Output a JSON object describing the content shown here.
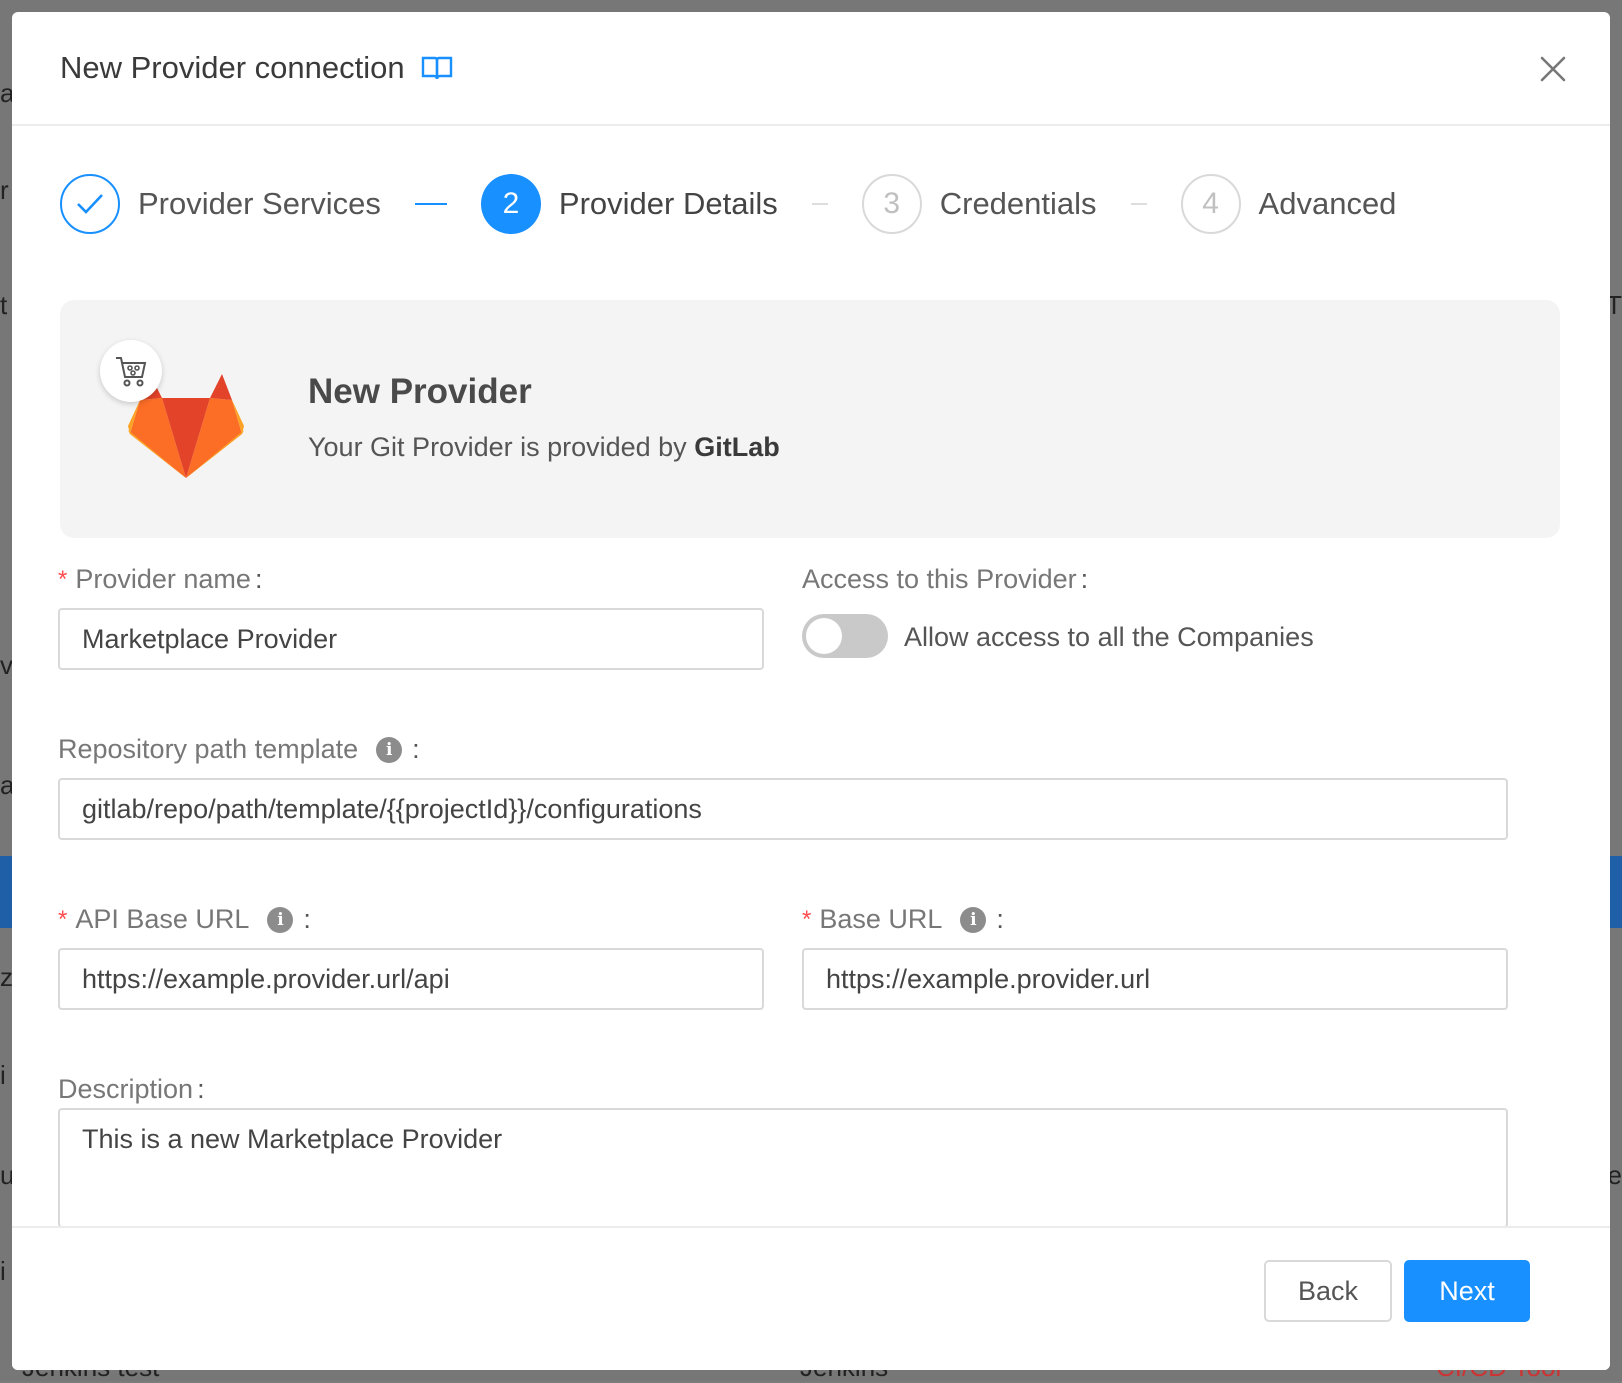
{
  "background": {
    "fragments": [
      "a",
      "r",
      "t",
      "v",
      "a",
      "z",
      "i",
      "u",
      "i",
      "e",
      "T"
    ],
    "bottom_left_text": "Jenkins test",
    "bottom_mid_text": "Jenkins",
    "bottom_right_text": "CI/CD Tool"
  },
  "modal": {
    "title": "New Provider connection",
    "title_icon": "book-icon",
    "close_icon": "close-icon"
  },
  "steps": [
    {
      "number": "1",
      "label": "Provider Services",
      "status": "done"
    },
    {
      "number": "2",
      "label": "Provider Details",
      "status": "active"
    },
    {
      "number": "3",
      "label": "Credentials",
      "status": "wait"
    },
    {
      "number": "4",
      "label": "Advanced",
      "status": "wait"
    }
  ],
  "provider_card": {
    "title": "New Provider",
    "subtitle_prefix": "Your Git Provider is provided by",
    "provider_brand": "GitLab",
    "logo_icon": "gitlab-logo",
    "badge_icon": "marketplace-cart-icon"
  },
  "form": {
    "provider_name": {
      "label": "Provider name",
      "required": true,
      "value": "Marketplace Provider"
    },
    "access": {
      "label": "Access to this Provider",
      "toggle_label": "Allow access to all the Companies",
      "enabled": false
    },
    "repo_path": {
      "label": "Repository path template",
      "value": "gitlab/repo/path/template/{{projectId}}/configurations"
    },
    "api_base_url": {
      "label": "API Base URL",
      "required": true,
      "value": "https://example.provider.url/api"
    },
    "base_url": {
      "label": "Base URL",
      "required": true,
      "value": "https://example.provider.url"
    },
    "description": {
      "label": "Description",
      "value": "This is a new Marketplace Provider"
    }
  },
  "footer": {
    "back_label": "Back",
    "next_label": "Next"
  },
  "colors": {
    "primary": "#1890ff",
    "required": "#ff4d4f",
    "gitlab_orange": "#fc6d26",
    "gitlab_red": "#e24329",
    "gitlab_yellow": "#fca326"
  }
}
